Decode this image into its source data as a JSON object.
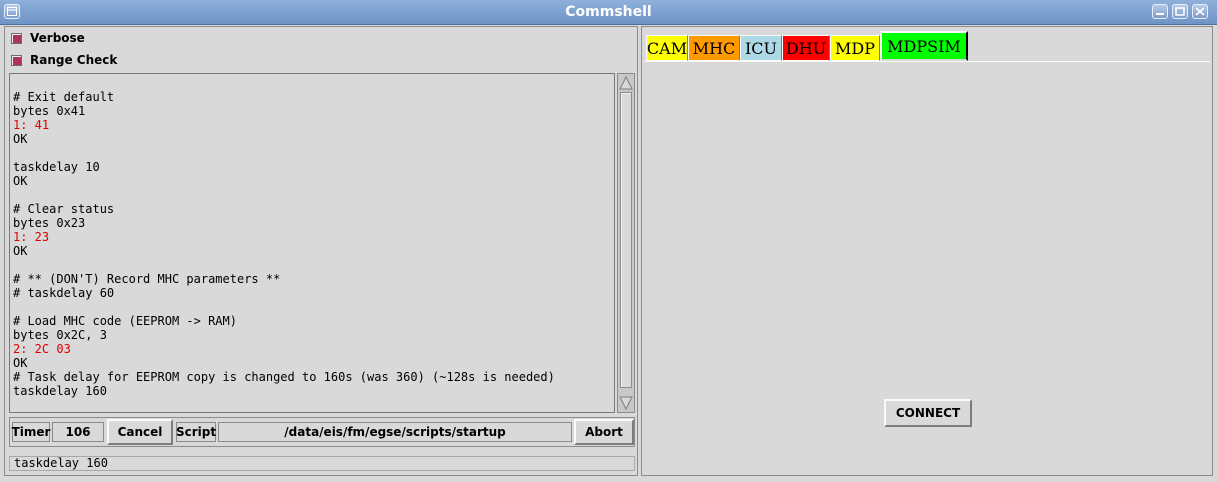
{
  "window": {
    "title": "Commshell",
    "title_bar_color": "#7a9bcb"
  },
  "left": {
    "checkboxes": [
      {
        "label": "Verbose",
        "checked": true
      },
      {
        "label": "Range Check",
        "checked": true
      }
    ],
    "console_lines": [
      {
        "text": "# Exit default",
        "color": "#000000"
      },
      {
        "text": "bytes 0x41",
        "color": "#000000"
      },
      {
        "text": "1: 41",
        "color": "#e00000"
      },
      {
        "text": "OK",
        "color": "#000000"
      },
      {
        "text": "",
        "color": "#000000"
      },
      {
        "text": "taskdelay 10",
        "color": "#000000"
      },
      {
        "text": "OK",
        "color": "#000000"
      },
      {
        "text": "",
        "color": "#000000"
      },
      {
        "text": "# Clear status",
        "color": "#000000"
      },
      {
        "text": "bytes 0x23",
        "color": "#000000"
      },
      {
        "text": "1: 23",
        "color": "#e00000"
      },
      {
        "text": "OK",
        "color": "#000000"
      },
      {
        "text": "",
        "color": "#000000"
      },
      {
        "text": "# ** (DON'T) Record MHC parameters **",
        "color": "#000000"
      },
      {
        "text": "# taskdelay 60",
        "color": "#000000"
      },
      {
        "text": "",
        "color": "#000000"
      },
      {
        "text": "# Load MHC code (EEPROM -> RAM)",
        "color": "#000000"
      },
      {
        "text": "bytes 0x2C, 3",
        "color": "#000000"
      },
      {
        "text": "2: 2C 03",
        "color": "#e00000"
      },
      {
        "text": "OK",
        "color": "#000000"
      },
      {
        "text": "# Task delay for EEPROM copy is changed to 160s (was 360) (~128s is needed)",
        "color": "#000000"
      },
      {
        "text": "taskdelay 160",
        "color": "#000000"
      }
    ],
    "status": {
      "timer_label": "Timer",
      "timer_value": "106",
      "cancel_label": "Cancel",
      "script_label": "Script",
      "script_path": "/data/eis/fm/egse/scripts/startup",
      "abort_label": "Abort"
    },
    "command_line": "taskdelay 160"
  },
  "right": {
    "tabs": [
      {
        "label": "CAM",
        "color": "#ffff00"
      },
      {
        "label": "MHC",
        "color": "#ff9900"
      },
      {
        "label": "ICU",
        "color": "#add8e6"
      },
      {
        "label": "DHU",
        "color": "#ff0000"
      },
      {
        "label": "MDP",
        "color": "#ffff00"
      },
      {
        "label": "MDPSIM",
        "color": "#00ff00"
      }
    ],
    "active_tab": "MDPSIM",
    "connect_label": "CONNECT"
  }
}
